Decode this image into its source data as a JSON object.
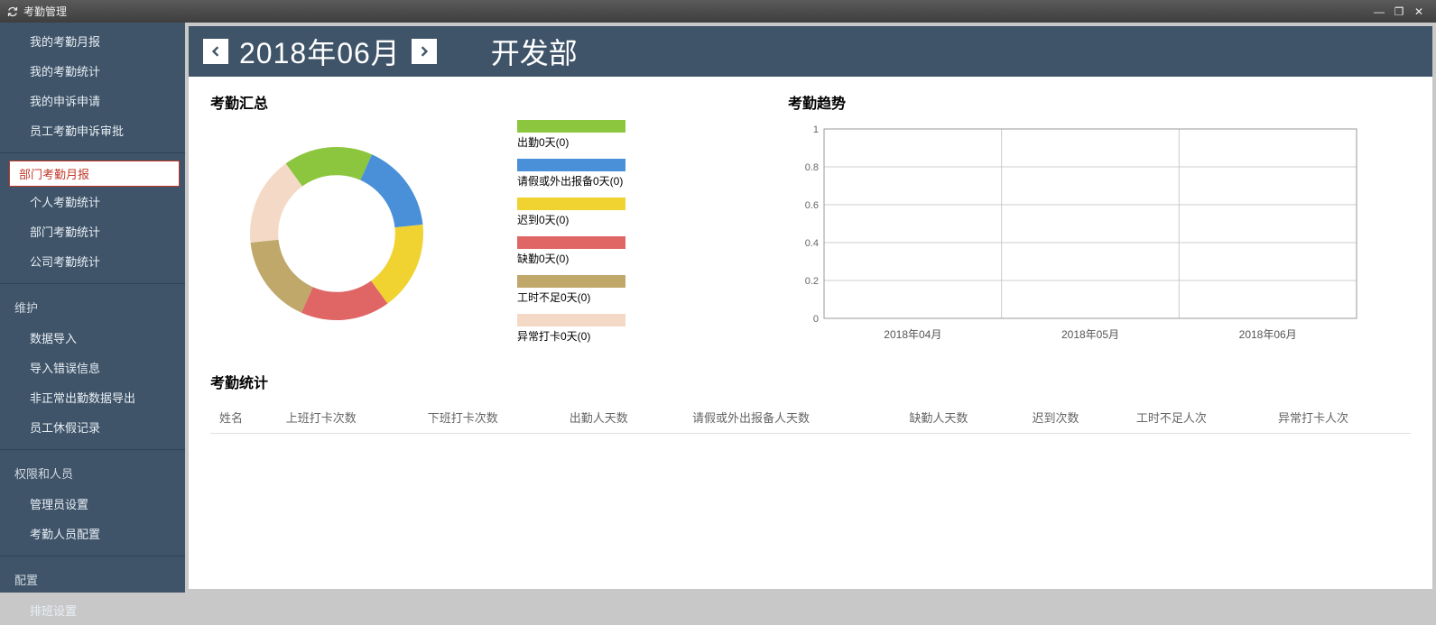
{
  "window": {
    "title": "考勤管理"
  },
  "sidebar": {
    "group1": [
      {
        "label": "我的考勤月报"
      },
      {
        "label": "我的考勤统计"
      },
      {
        "label": "我的申诉申请"
      },
      {
        "label": "员工考勤申诉审批"
      }
    ],
    "group2": [
      {
        "label": "部门考勤月报",
        "selected": true
      },
      {
        "label": "个人考勤统计"
      },
      {
        "label": "部门考勤统计"
      },
      {
        "label": "公司考勤统计"
      }
    ],
    "group3_header": "维护",
    "group3": [
      {
        "label": "数据导入"
      },
      {
        "label": "导入错误信息"
      },
      {
        "label": "非正常出勤数据导出"
      },
      {
        "label": "员工休假记录"
      }
    ],
    "group4_header": "权限和人员",
    "group4": [
      {
        "label": "管理员设置"
      },
      {
        "label": "考勤人员配置"
      }
    ],
    "group5_header": "配置",
    "group5": [
      {
        "label": "排班设置"
      }
    ]
  },
  "header": {
    "date": "2018年06月",
    "department": "开发部"
  },
  "summary_title": "考勤汇总",
  "trend_title": "考勤趋势",
  "stats_title": "考勤统计",
  "legend": [
    {
      "color": "#8cc63f",
      "label": "出勤0天(0)"
    },
    {
      "color": "#4a90d9",
      "label": "请假或外出报备0天(0)"
    },
    {
      "color": "#f0d330",
      "label": "迟到0天(0)"
    },
    {
      "color": "#e06666",
      "label": "缺勤0天(0)"
    },
    {
      "color": "#bfa86a",
      "label": "工时不足0天(0)"
    },
    {
      "color": "#f4d9c6",
      "label": "异常打卡0天(0)"
    }
  ],
  "table_headers": [
    "姓名",
    "上班打卡次数",
    "下班打卡次数",
    "出勤人天数",
    "请假或外出报备人天数",
    "缺勤人天数",
    "迟到次数",
    "工时不足人次",
    "异常打卡人次"
  ],
  "chart_data": [
    {
      "type": "pie",
      "title": "考勤汇总",
      "series": [
        {
          "name": "出勤0天(0)",
          "value": 0,
          "color": "#8cc63f"
        },
        {
          "name": "请假或外出报备0天(0)",
          "value": 0,
          "color": "#4a90d9"
        },
        {
          "name": "迟到0天(0)",
          "value": 0,
          "color": "#f0d330"
        },
        {
          "name": "缺勤0天(0)",
          "value": 0,
          "color": "#e06666"
        },
        {
          "name": "工时不足0天(0)",
          "value": 0,
          "color": "#bfa86a"
        },
        {
          "name": "异常打卡0天(0)",
          "value": 0,
          "color": "#f4d9c6"
        }
      ],
      "note": "All values zero — rendered as equal placeholder slices"
    },
    {
      "type": "line",
      "title": "考勤趋势",
      "x": [
        "2018年04月",
        "2018年05月",
        "2018年06月"
      ],
      "series": [],
      "ylim": [
        0,
        1
      ],
      "yticks": [
        0,
        0.2,
        0.4,
        0.6,
        0.8,
        1
      ],
      "grid": true
    }
  ]
}
